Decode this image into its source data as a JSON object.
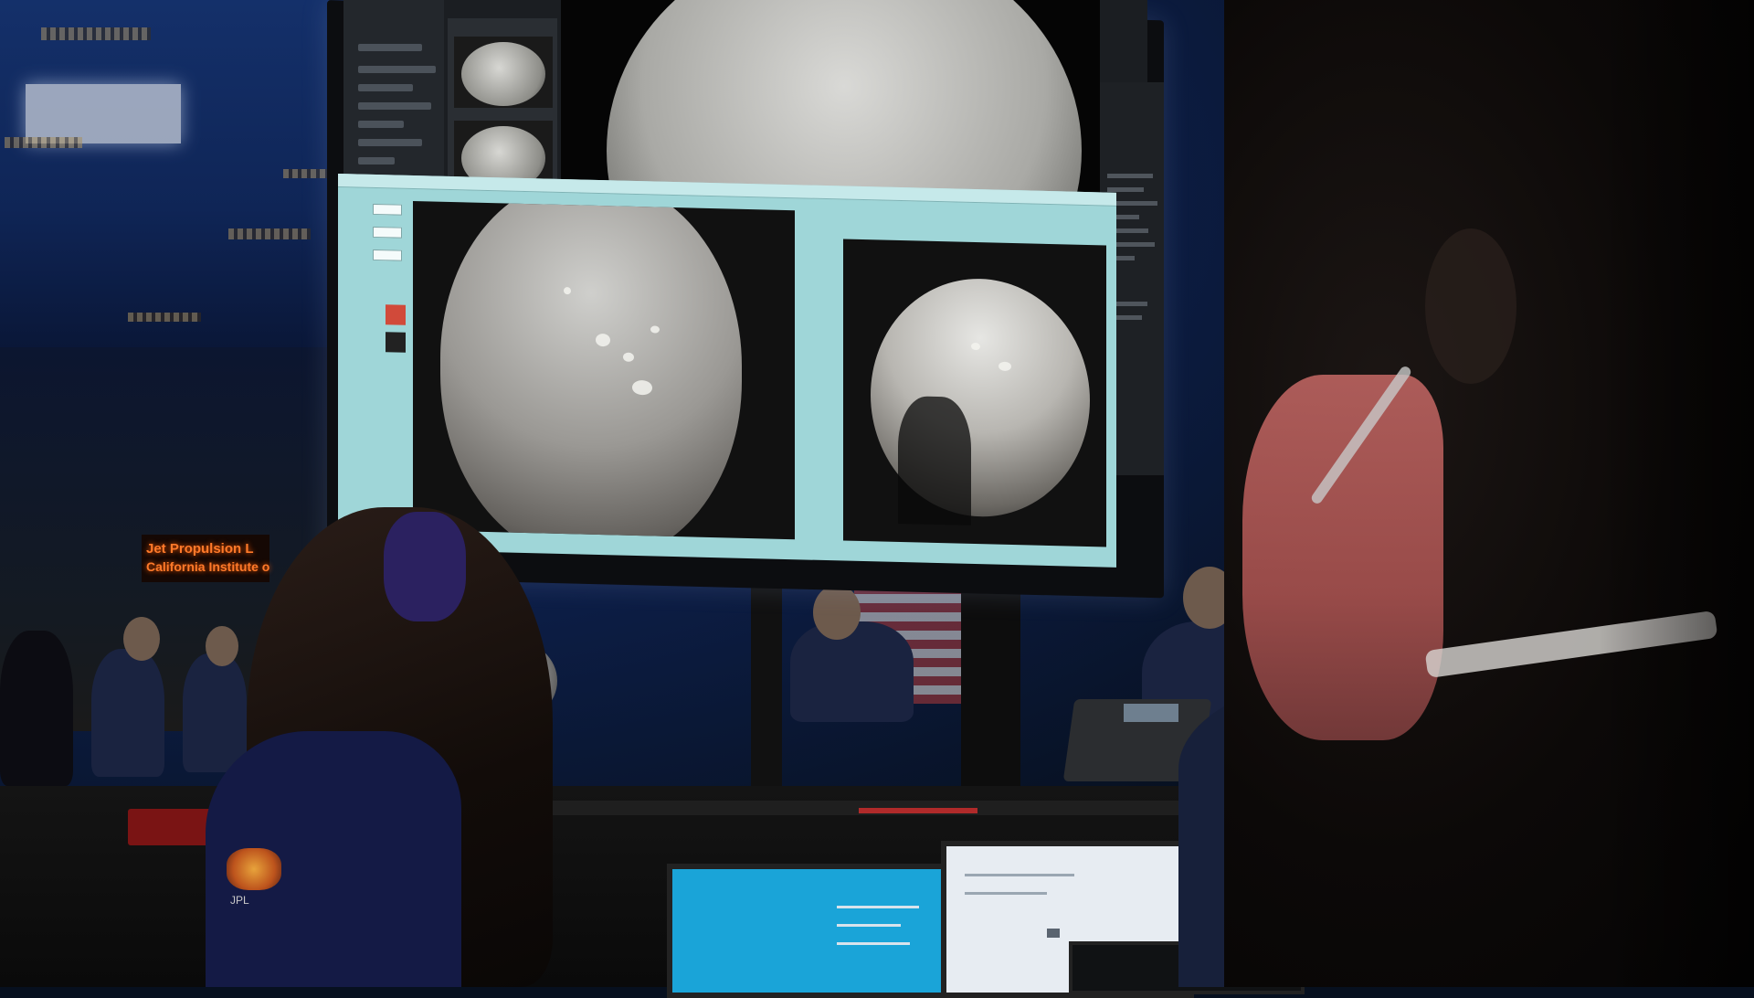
{
  "scene": {
    "description_type": "photograph",
    "accent_colors": {
      "viewer_background": "#9fd6d8",
      "sign_text": "#ff7a2a",
      "ceiling_blue": "#14306a"
    }
  },
  "sign": {
    "line1": "Jet Propulsion L",
    "line2": "California Institute o"
  },
  "shirt_logo": {
    "text": "JPL"
  }
}
